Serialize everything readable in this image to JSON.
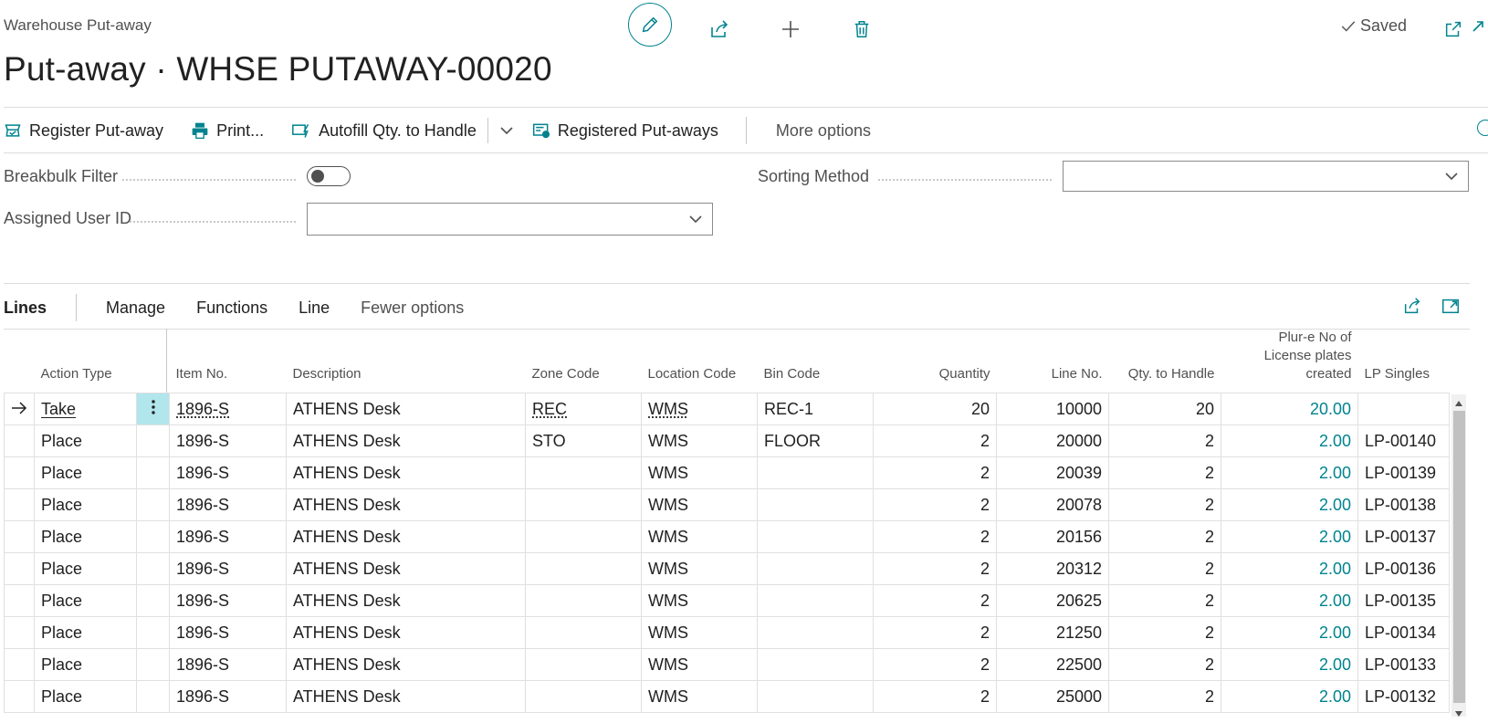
{
  "header": {
    "breadcrumb": "Warehouse Put-away",
    "title": "Put-away · WHSE PUTAWAY-00020",
    "saved_label": "Saved"
  },
  "actions": {
    "register": "Register Put-away",
    "print": "Print...",
    "autofill": "Autofill Qty. to Handle",
    "registered": "Registered Put-aways",
    "more": "More options"
  },
  "fields": {
    "breakbulk_label": "Breakbulk Filter",
    "breakbulk_value": false,
    "assigned_user_label": "Assigned User ID",
    "assigned_user_value": "",
    "sorting_label": "Sorting Method",
    "sorting_value": ""
  },
  "lines": {
    "title": "Lines",
    "menu": [
      "Manage",
      "Functions",
      "Line",
      "Fewer options"
    ],
    "columns": {
      "action_type": "Action Type",
      "item_no": "Item No.",
      "description": "Description",
      "zone_code": "Zone Code",
      "location_code": "Location Code",
      "bin_code": "Bin Code",
      "quantity": "Quantity",
      "line_no": "Line No.",
      "qty_to_handle": "Qty. to Handle",
      "plure_line1": "Plur-e No of",
      "plure_line2": "License plates",
      "plure_line3": "created",
      "lp_singles": "LP Singles"
    },
    "rows": [
      {
        "action_type": "Take",
        "item_no": "1896-S",
        "description": "ATHENS Desk",
        "zone_code": "REC",
        "location_code": "WMS",
        "bin_code": "REC-1",
        "quantity": "20",
        "line_no": "10000",
        "qty_to_handle": "20",
        "plure": "20.00",
        "lp_singles": ""
      },
      {
        "action_type": "Place",
        "item_no": "1896-S",
        "description": "ATHENS Desk",
        "zone_code": "STO",
        "location_code": "WMS",
        "bin_code": "FLOOR",
        "quantity": "2",
        "line_no": "20000",
        "qty_to_handle": "2",
        "plure": "2.00",
        "lp_singles": "LP-00140"
      },
      {
        "action_type": "Place",
        "item_no": "1896-S",
        "description": "ATHENS Desk",
        "zone_code": "",
        "location_code": "WMS",
        "bin_code": "",
        "quantity": "2",
        "line_no": "20039",
        "qty_to_handle": "2",
        "plure": "2.00",
        "lp_singles": "LP-00139"
      },
      {
        "action_type": "Place",
        "item_no": "1896-S",
        "description": "ATHENS Desk",
        "zone_code": "",
        "location_code": "WMS",
        "bin_code": "",
        "quantity": "2",
        "line_no": "20078",
        "qty_to_handle": "2",
        "plure": "2.00",
        "lp_singles": "LP-00138"
      },
      {
        "action_type": "Place",
        "item_no": "1896-S",
        "description": "ATHENS Desk",
        "zone_code": "",
        "location_code": "WMS",
        "bin_code": "",
        "quantity": "2",
        "line_no": "20156",
        "qty_to_handle": "2",
        "plure": "2.00",
        "lp_singles": "LP-00137"
      },
      {
        "action_type": "Place",
        "item_no": "1896-S",
        "description": "ATHENS Desk",
        "zone_code": "",
        "location_code": "WMS",
        "bin_code": "",
        "quantity": "2",
        "line_no": "20312",
        "qty_to_handle": "2",
        "plure": "2.00",
        "lp_singles": "LP-00136"
      },
      {
        "action_type": "Place",
        "item_no": "1896-S",
        "description": "ATHENS Desk",
        "zone_code": "",
        "location_code": "WMS",
        "bin_code": "",
        "quantity": "2",
        "line_no": "20625",
        "qty_to_handle": "2",
        "plure": "2.00",
        "lp_singles": "LP-00135"
      },
      {
        "action_type": "Place",
        "item_no": "1896-S",
        "description": "ATHENS Desk",
        "zone_code": "",
        "location_code": "WMS",
        "bin_code": "",
        "quantity": "2",
        "line_no": "21250",
        "qty_to_handle": "2",
        "plure": "2.00",
        "lp_singles": "LP-00134"
      },
      {
        "action_type": "Place",
        "item_no": "1896-S",
        "description": "ATHENS Desk",
        "zone_code": "",
        "location_code": "WMS",
        "bin_code": "",
        "quantity": "2",
        "line_no": "22500",
        "qty_to_handle": "2",
        "plure": "2.00",
        "lp_singles": "LP-00133"
      },
      {
        "action_type": "Place",
        "item_no": "1896-S",
        "description": "ATHENS Desk",
        "zone_code": "",
        "location_code": "WMS",
        "bin_code": "",
        "quantity": "2",
        "line_no": "25000",
        "qty_to_handle": "2",
        "plure": "2.00",
        "lp_singles": "LP-00132"
      }
    ]
  },
  "colors": {
    "accent": "#00838f",
    "active_cell": "#b0e6ec"
  }
}
